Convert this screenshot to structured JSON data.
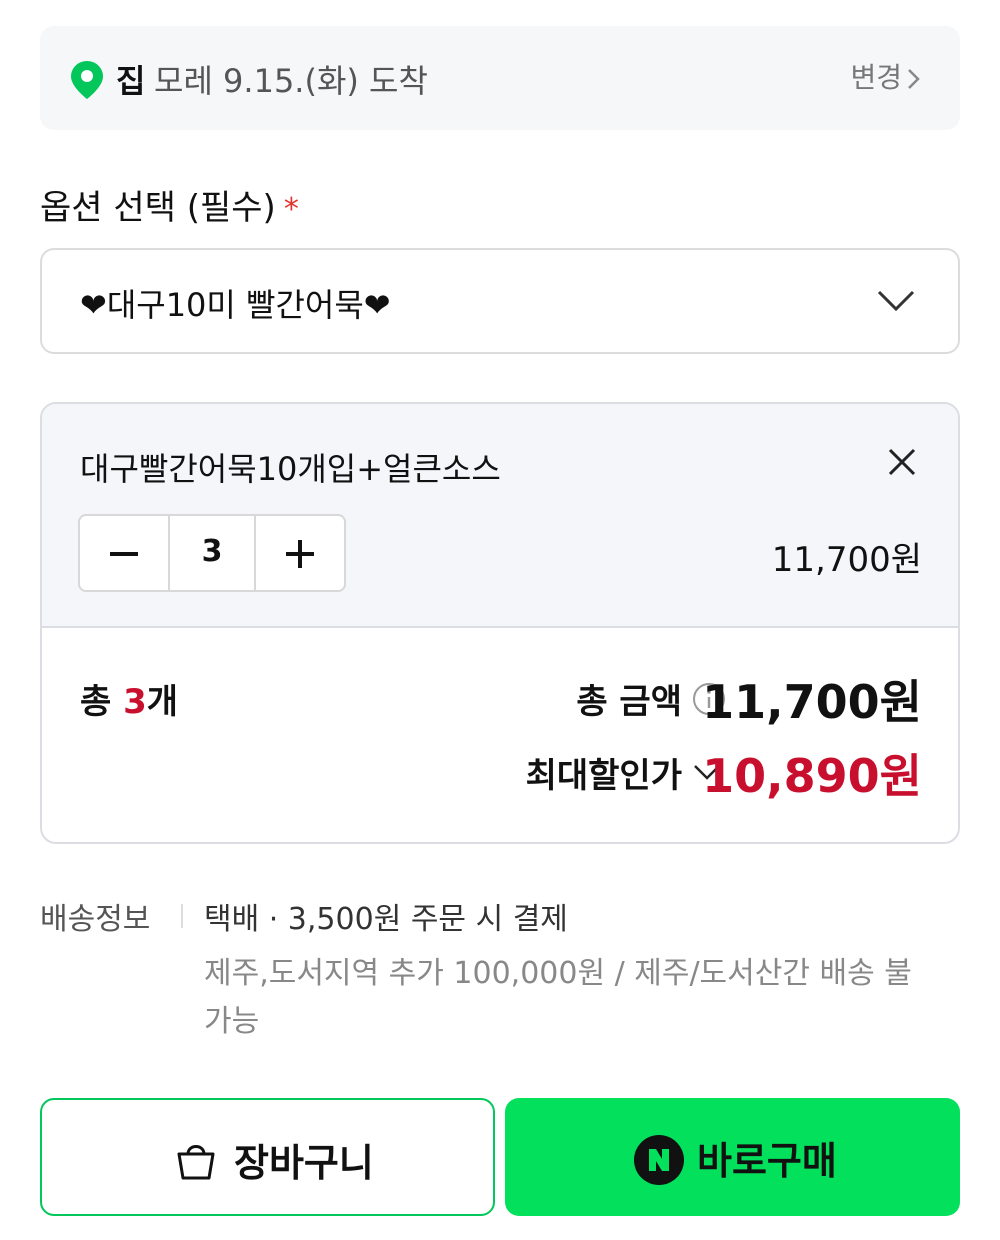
{
  "delivery": {
    "location": "집",
    "arrival": "모레 9.15.(화) 도착",
    "change_label": "변경"
  },
  "option": {
    "title": "옵션 선택 (필수)",
    "required_mark": "*",
    "selected_value": "❤대구10미 빨간어묵❤"
  },
  "selected_item": {
    "name": "대구빨간어묵10개입+얼큰소스",
    "quantity": "3",
    "price": "11,700원"
  },
  "summary": {
    "count_prefix": "총 ",
    "count": "3",
    "count_suffix": "개",
    "total_label": "총 금액",
    "total_amount": "11,700원",
    "discount_label": "최대할인가",
    "discount_amount": "10,890원"
  },
  "shipping": {
    "label": "배송정보",
    "main": "택배 · 3,500원 주문 시 결제",
    "extra": "제주,도서지역 추가 100,000원 / 제주/도서산간 배송 불가능"
  },
  "buttons": {
    "cart_label": "장바구니",
    "buy_label": "바로구매"
  },
  "colors": {
    "accent_green": "#03e05c",
    "border_green": "#03c75a",
    "discount_red": "#c8102e",
    "pin_green": "#03c75a"
  },
  "icons": {
    "pin": "location-pin-icon",
    "chevron": "chevron-right-icon",
    "dropdown": "chevron-down-icon",
    "close": "close-icon",
    "minus": "minus-icon",
    "plus": "plus-icon",
    "info": "info-icon",
    "bag": "shopping-bag-icon",
    "naver": "naver-n-logo"
  }
}
